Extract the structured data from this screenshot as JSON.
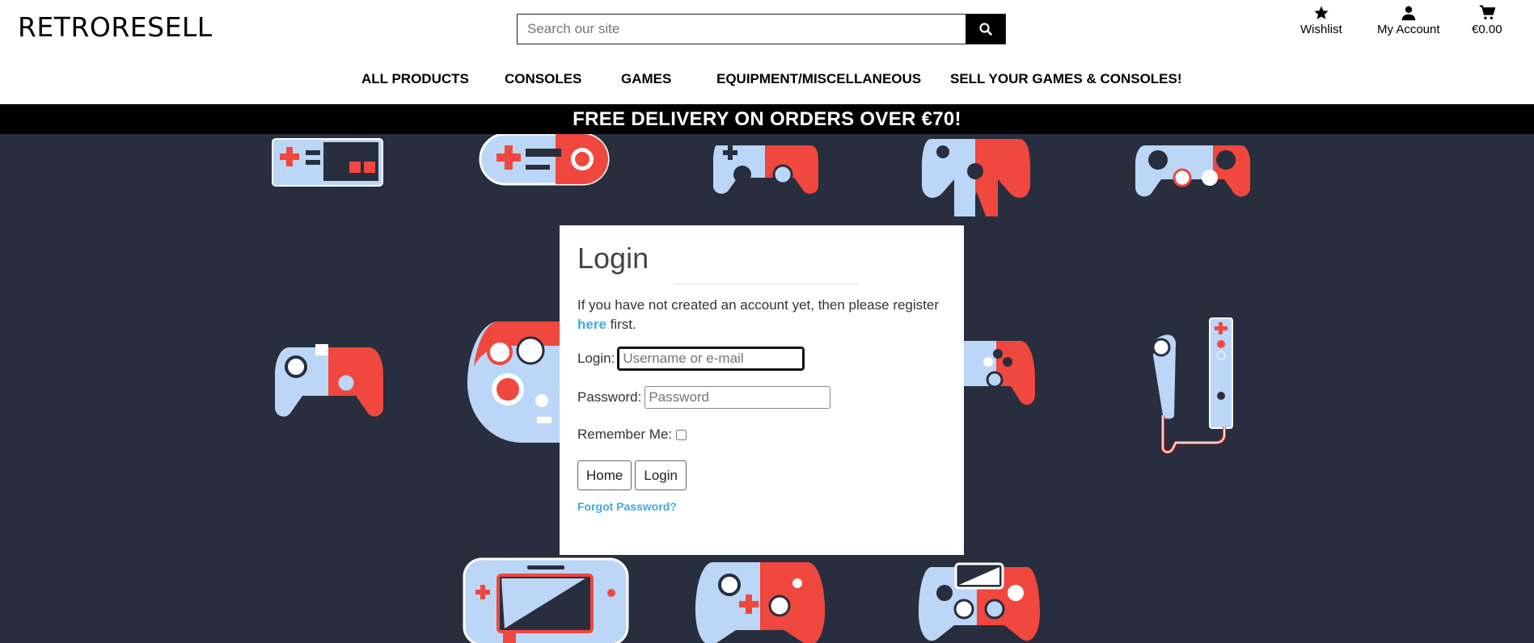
{
  "brand": "RETRORESELL",
  "search": {
    "placeholder": "Search our site"
  },
  "header_icons": {
    "wishlist": "Wishlist",
    "account": "My Account",
    "cart": "€0.00"
  },
  "nav": [
    "ALL PRODUCTS",
    "CONSOLES",
    "GAMES",
    "EQUIPMENT/MISCELLANEOUS",
    "SELL YOUR GAMES & CONSOLES!"
  ],
  "banner": "FREE DELIVERY ON ORDERS OVER €70!",
  "login": {
    "title": "Login",
    "intro_text": "If you have not created an account yet, then please register",
    "intro_link": "here",
    "intro_suffix": " first.",
    "login_label": "Login:",
    "login_placeholder": "Username or e-mail",
    "password_label": "Password:",
    "password_placeholder": "Password",
    "remember_label": "Remember Me:",
    "home_button": "Home",
    "login_button": "Login",
    "forgot_link": "Forgot Password?"
  },
  "colors": {
    "background": "#282e3d",
    "pad_red": "#f0473e",
    "pad_blue": "#bcd6f7",
    "link": "#3fa9e0"
  }
}
